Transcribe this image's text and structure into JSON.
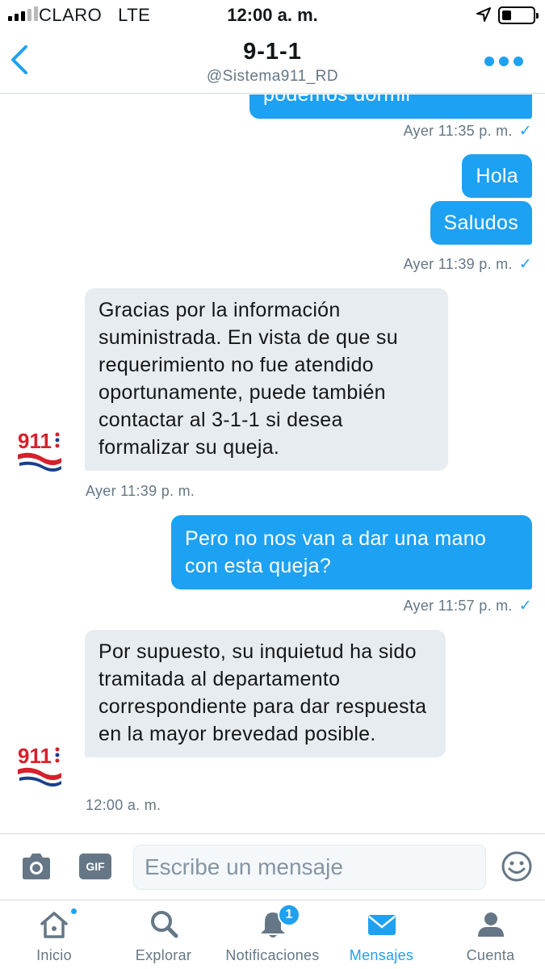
{
  "status_bar": {
    "carrier": "CLARO",
    "network": "LTE",
    "time": "12:00 a. m."
  },
  "header": {
    "title": "9-1-1",
    "handle": "@Sistema911_RD",
    "back_icon": "chevron-left-icon",
    "more_icon": "more-dots-icon"
  },
  "conversation": {
    "partial_message": "podemos dormir",
    "messages": [
      {
        "direction": "out",
        "text": "Hola"
      },
      {
        "direction": "out",
        "text": "Saludos"
      },
      {
        "direction": "in",
        "text": "Gracias por la información suministrada. En vista de que su requerimiento no fue atendido oportunamente, puede también contactar al 3-1-1 si desea formalizar su queja."
      },
      {
        "direction": "out",
        "text": "Pero no nos van a dar una mano con esta queja?"
      },
      {
        "direction": "in",
        "text": "Por supuesto, su inquietud ha sido tramitada al departamento correspondiente para dar respuesta en la mayor brevedad posible."
      }
    ],
    "timestamps": [
      "Ayer 11:35 p. m.",
      "Ayer 11:39 p. m.",
      "Ayer 11:39 p. m.",
      "Ayer 11:57 p. m.",
      "12:00 a. m."
    ],
    "read_mark": "✓",
    "avatar_text": "911"
  },
  "composer": {
    "gif_label": "GIF",
    "placeholder": "Escribe un mensaje"
  },
  "tabs": [
    {
      "label": "Inicio",
      "icon": "home-icon"
    },
    {
      "label": "Explorar",
      "icon": "search-icon"
    },
    {
      "label": "Notificaciones",
      "icon": "bell-icon",
      "badge": "1"
    },
    {
      "label": "Mensajes",
      "icon": "envelope-icon",
      "active": true
    },
    {
      "label": "Cuenta",
      "icon": "person-icon"
    }
  ],
  "colors": {
    "accent": "#1da1f2",
    "incoming_bubble": "#e6ecf0",
    "muted_text": "#657786"
  }
}
